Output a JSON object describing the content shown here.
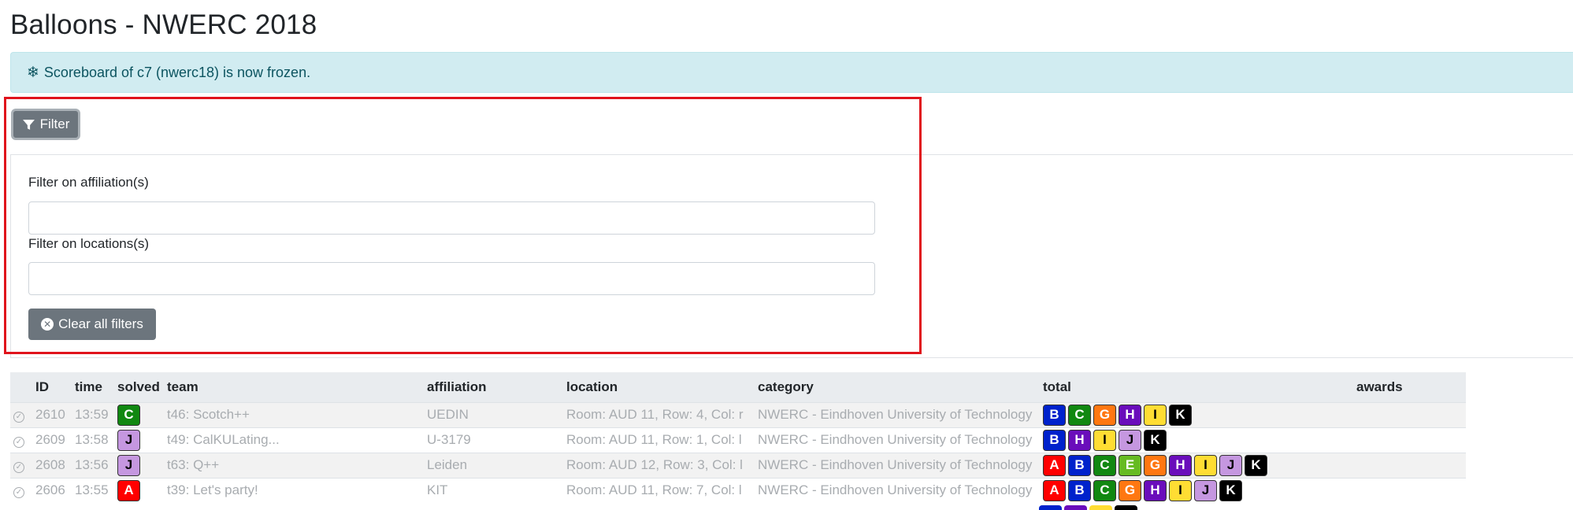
{
  "page": {
    "title": "Balloons - NWERC 2018"
  },
  "alert": {
    "icon": "snowflake-icon",
    "text": "Scoreboard of c7 (nwerc18) is now frozen."
  },
  "filter": {
    "button_label": "Filter",
    "affiliation_label": "Filter on affiliation(s)",
    "affiliation_value": "",
    "locations_label": "Filter on locations(s)",
    "locations_value": "",
    "clear_label": "Clear all filters"
  },
  "table": {
    "headers": [
      "ID",
      "time",
      "solved",
      "team",
      "affiliation",
      "location",
      "category",
      "total",
      "awards"
    ],
    "rows": [
      {
        "id": "2610",
        "time": "13:59",
        "solved": "C",
        "team": "t46: Scotch++",
        "affiliation": "UEDIN",
        "location": "Room: AUD 11, Row: 4, Col: r",
        "category": "NWERC - Eindhoven University of Technology",
        "total": [
          "B",
          "C",
          "G",
          "H",
          "I",
          "K"
        ]
      },
      {
        "id": "2609",
        "time": "13:58",
        "solved": "J",
        "team": "t49: CalKULating...",
        "affiliation": "U-3179",
        "location": "Room: AUD 11, Row: 1, Col: l",
        "category": "NWERC - Eindhoven University of Technology",
        "total": [
          "B",
          "H",
          "I",
          "J",
          "K"
        ]
      },
      {
        "id": "2608",
        "time": "13:56",
        "solved": "J",
        "team": "t63: Q++",
        "affiliation": "Leiden",
        "location": "Room: AUD 12, Row: 3, Col: l",
        "category": "NWERC - Eindhoven University of Technology",
        "total": [
          "A",
          "B",
          "C",
          "E",
          "G",
          "H",
          "I",
          "J",
          "K"
        ]
      },
      {
        "id": "2606",
        "time": "13:55",
        "solved": "A",
        "team": "t39: Let's party!",
        "affiliation": "KIT",
        "location": "Room: AUD 11, Row: 7, Col: l",
        "category": "NWERC - Eindhoven University of Technology",
        "total": [
          "A",
          "B",
          "C",
          "G",
          "H",
          "I",
          "J",
          "K"
        ]
      }
    ]
  },
  "balloon_colors": {
    "A": {
      "bg": "#ff0000",
      "fg": "#ffffff"
    },
    "B": {
      "bg": "#0022cc",
      "fg": "#ffffff"
    },
    "C": {
      "bg": "#118811",
      "fg": "#ffffff"
    },
    "E": {
      "bg": "#66bb22",
      "fg": "#ffffff"
    },
    "G": {
      "bg": "#ff7711",
      "fg": "#ffffff"
    },
    "H": {
      "bg": "#6a0dbb",
      "fg": "#ffffff"
    },
    "I": {
      "bg": "#ffdd33",
      "fg": "#000000"
    },
    "J": {
      "bg": "#c597e0",
      "fg": "#000000"
    },
    "K": {
      "bg": "#000000",
      "fg": "#ffffff"
    }
  }
}
